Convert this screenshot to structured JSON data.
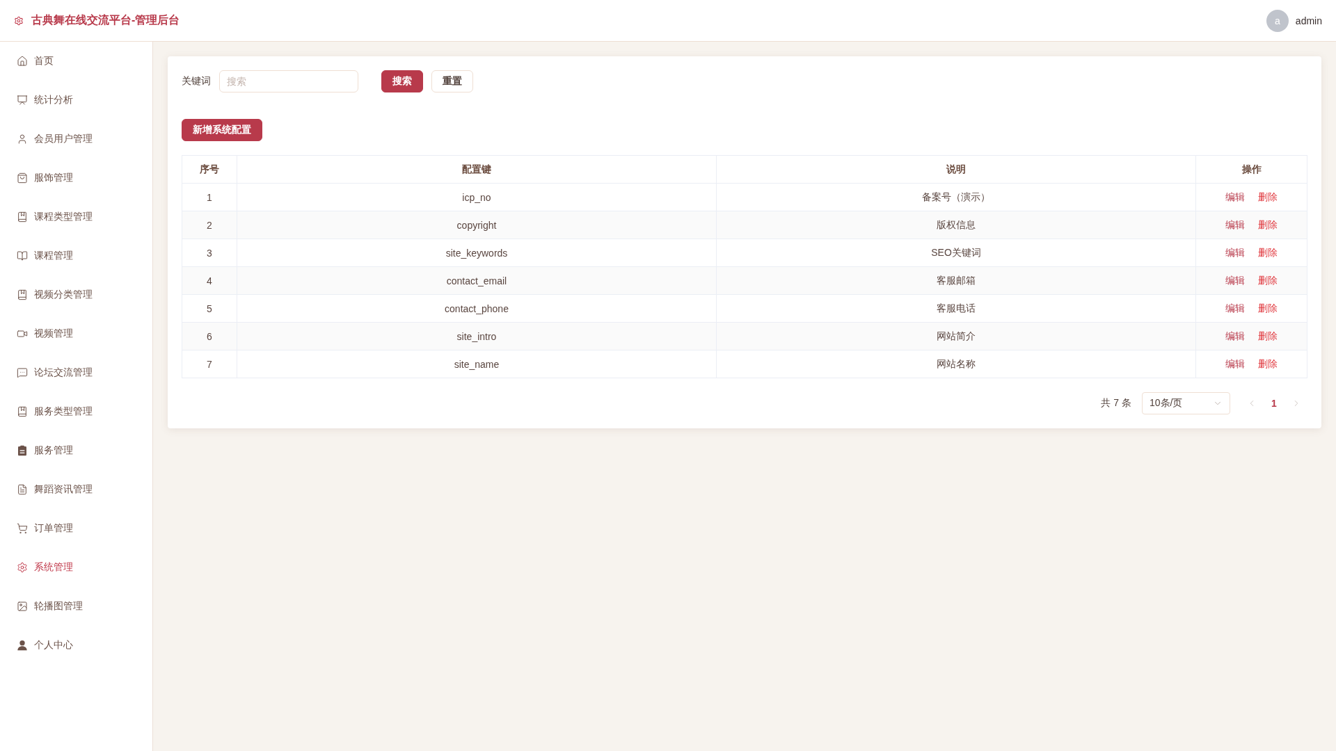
{
  "header": {
    "title": "古典舞在线交流平台-管理后台",
    "user": {
      "avatar_letter": "a",
      "name": "admin"
    }
  },
  "sidebar": {
    "items": [
      {
        "label": "首页",
        "selected": false
      },
      {
        "label": "统计分析",
        "selected": false
      },
      {
        "label": "会员用户管理",
        "selected": false
      },
      {
        "label": "服饰管理",
        "selected": false
      },
      {
        "label": "课程类型管理",
        "selected": false
      },
      {
        "label": "课程管理",
        "selected": false
      },
      {
        "label": "视频分类管理",
        "selected": false
      },
      {
        "label": "视频管理",
        "selected": false
      },
      {
        "label": "论坛交流管理",
        "selected": false
      },
      {
        "label": "服务类型管理",
        "selected": false
      },
      {
        "label": "服务管理",
        "selected": false
      },
      {
        "label": "舞蹈资讯管理",
        "selected": false
      },
      {
        "label": "订单管理",
        "selected": false
      },
      {
        "label": "系统管理",
        "selected": true
      },
      {
        "label": "轮播图管理",
        "selected": false
      },
      {
        "label": "个人中心",
        "selected": false
      }
    ]
  },
  "search": {
    "label": "关键词",
    "placeholder": "搜索",
    "buttons": [
      {
        "kind": "primary",
        "label": "搜索"
      },
      {
        "kind": "default",
        "label": "重置"
      }
    ]
  },
  "add_button": "新增系统配置",
  "table": {
    "columns": [
      "序号",
      "配置键",
      "说明",
      "操作"
    ],
    "rows": [
      {
        "cells": [
          "1",
          "icp_no",
          "备案号（演示）"
        ],
        "actions": [
          {
            "kind": "edit",
            "label": "编辑"
          },
          {
            "kind": "delete",
            "label": "删除"
          }
        ]
      },
      {
        "cells": [
          "2",
          "copyright",
          "版权信息"
        ],
        "actions": [
          {
            "kind": "edit",
            "label": "编辑"
          },
          {
            "kind": "delete",
            "label": "删除"
          }
        ]
      },
      {
        "cells": [
          "3",
          "site_keywords",
          "SEO关键词"
        ],
        "actions": [
          {
            "kind": "edit",
            "label": "编辑"
          },
          {
            "kind": "delete",
            "label": "删除"
          }
        ]
      },
      {
        "cells": [
          "4",
          "contact_email",
          "客服邮箱"
        ],
        "actions": [
          {
            "kind": "edit",
            "label": "编辑"
          },
          {
            "kind": "delete",
            "label": "删除"
          }
        ]
      },
      {
        "cells": [
          "5",
          "contact_phone",
          "客服电话"
        ],
        "actions": [
          {
            "kind": "edit",
            "label": "编辑"
          },
          {
            "kind": "delete",
            "label": "删除"
          }
        ]
      },
      {
        "cells": [
          "6",
          "site_intro",
          "网站简介"
        ],
        "actions": [
          {
            "kind": "edit",
            "label": "编辑"
          },
          {
            "kind": "delete",
            "label": "删除"
          }
        ]
      },
      {
        "cells": [
          "7",
          "site_name",
          "网站名称"
        ],
        "actions": [
          {
            "kind": "edit",
            "label": "编辑"
          },
          {
            "kind": "delete",
            "label": "删除"
          }
        ]
      }
    ]
  },
  "pagination": {
    "total": "共 7 条",
    "page_size": "10条/页",
    "pages": [
      {
        "label": "1",
        "selected": true
      }
    ]
  }
}
